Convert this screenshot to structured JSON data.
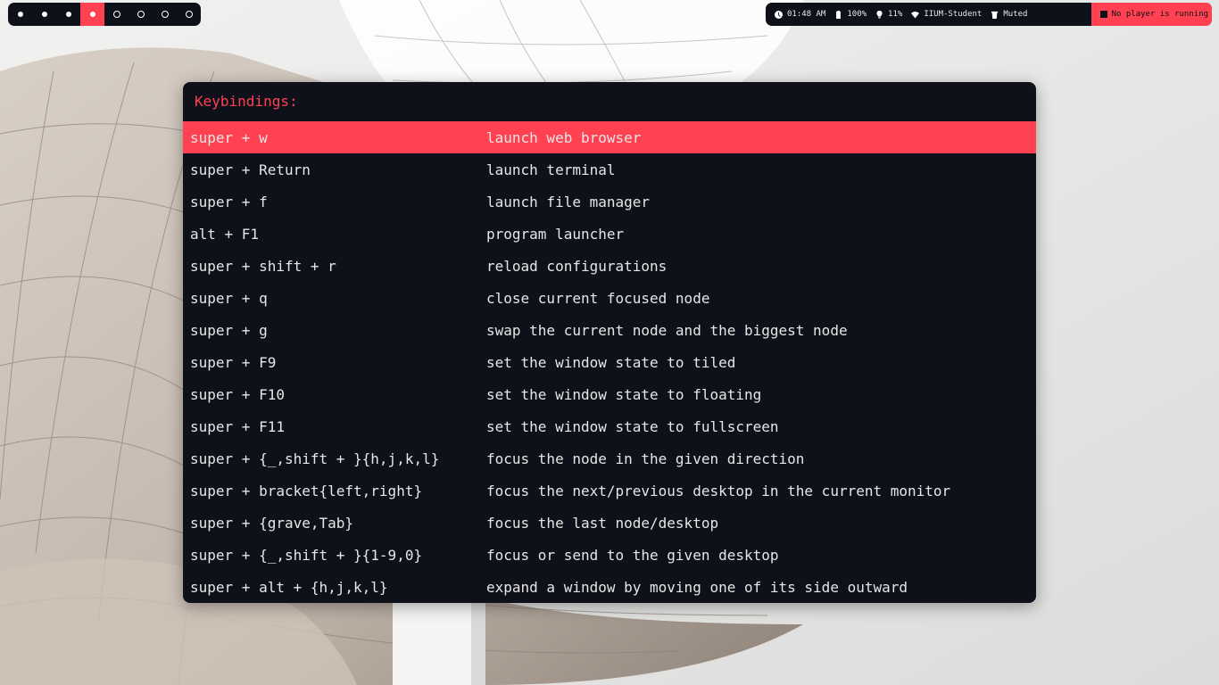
{
  "workspaces": [
    {
      "state": "filled",
      "active": false
    },
    {
      "state": "filled",
      "active": false
    },
    {
      "state": "filled",
      "active": false
    },
    {
      "state": "filled",
      "active": true
    },
    {
      "state": "empty",
      "active": false
    },
    {
      "state": "empty",
      "active": false
    },
    {
      "state": "empty",
      "active": false
    },
    {
      "state": "empty",
      "active": false
    }
  ],
  "status": {
    "clock": {
      "icon": "clock-icon",
      "text": "01:48 AM"
    },
    "battery": {
      "icon": "battery-icon",
      "text": "100%"
    },
    "brightness": {
      "icon": "lightbulb-icon",
      "text": "11%"
    },
    "network": {
      "icon": "wifi-icon",
      "text": "IIUM-Student"
    },
    "volume": {
      "icon": "volume-icon",
      "text": "Muted"
    },
    "player": {
      "icon": "stop-icon",
      "text": "No player is running"
    }
  },
  "colors": {
    "accent": "#ff4151",
    "panel": "#0f111a",
    "text": "#e6e6e6"
  },
  "keybindings": {
    "title": "Keybindings:",
    "selected_index": 0,
    "rows": [
      {
        "key": "super + w",
        "desc": "launch web browser"
      },
      {
        "key": "super + Return",
        "desc": "launch terminal"
      },
      {
        "key": "super + f",
        "desc": "launch file manager"
      },
      {
        "key": "alt + F1",
        "desc": "program launcher"
      },
      {
        "key": "super + shift + r",
        "desc": "reload configurations"
      },
      {
        "key": "super + q",
        "desc": "close current focused node"
      },
      {
        "key": "super + g",
        "desc": "swap the current node and the biggest node"
      },
      {
        "key": "super + F9",
        "desc": "set the window state to tiled"
      },
      {
        "key": "super + F10",
        "desc": "set the window state to floating"
      },
      {
        "key": "super + F11",
        "desc": "set the window state to fullscreen"
      },
      {
        "key": "super + {_,shift + }{h,j,k,l}",
        "desc": "focus the node in the given direction"
      },
      {
        "key": "super + bracket{left,right}",
        "desc": "focus the next/previous desktop in the current monitor"
      },
      {
        "key": "super + {grave,Tab}",
        "desc": "focus the last node/desktop"
      },
      {
        "key": "super + {_,shift + }{1-9,0}",
        "desc": "focus or send to the given desktop"
      },
      {
        "key": "super + alt + {h,j,k,l}",
        "desc": "expand a window by moving one of its side outward"
      }
    ]
  }
}
